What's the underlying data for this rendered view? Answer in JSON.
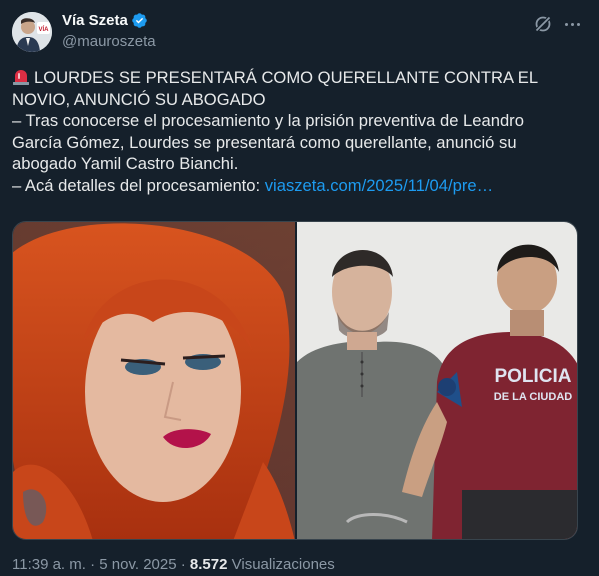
{
  "author": {
    "display_name": "Vía Szeta",
    "handle": "@mauroszeta",
    "verified": true
  },
  "tweet": {
    "line1": "LOURDES SE PRESENTARÁ COMO QUERELLANTE CONTRA EL",
    "line2": "NOVIO, ANUNCIÓ SU ABOGADO",
    "line3": "– Tras conocerse el procesamiento y la prisión preventiva de Leandro",
    "line4": "García Gómez, Lourdes se presentará como querellante, anunció su",
    "line5": "abogado Yamil Castro Bianchi.",
    "line6_prefix": "– Acá detalles del procesamiento: ",
    "link_text": "viaszeta.com/2025/11/04/pre…"
  },
  "media": {
    "right_vest_line1": "POLICIA",
    "right_vest_line2": "DE LA CIUDAD"
  },
  "meta": {
    "time": "11:39 a. m.",
    "separator": " · ",
    "date": "5 nov. 2025",
    "separator2": " · ",
    "views_count": "8.572",
    "views_label": " Visualizaciones"
  },
  "colors": {
    "background": "#15202b",
    "link": "#1d9bf0",
    "verified": "#1d9bf0",
    "secondary_text": "#8b98a5"
  },
  "icons": [
    "avatar",
    "verified-badge-icon",
    "grok-icon",
    "more-options-icon",
    "siren-emoji-icon"
  ]
}
